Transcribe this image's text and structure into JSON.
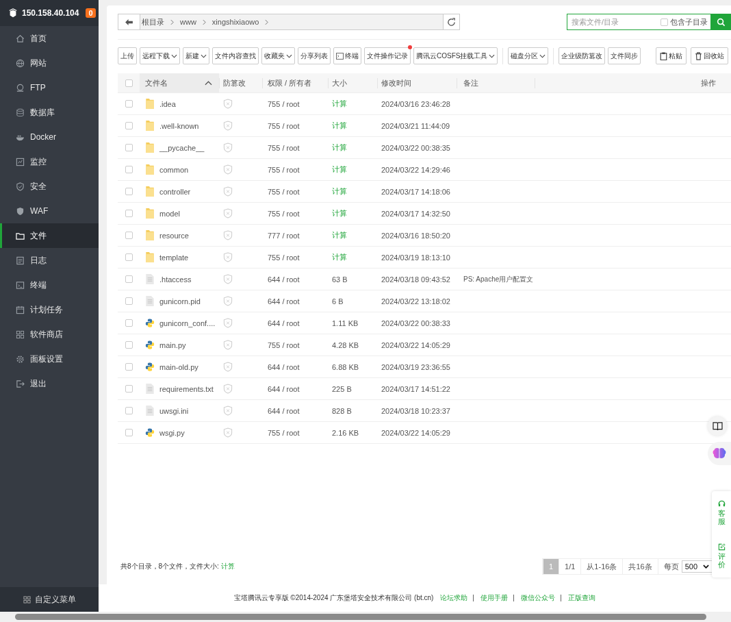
{
  "server": {
    "ip": "150.158.40.104",
    "badge": "0"
  },
  "nav": [
    {
      "label": "首页",
      "selected": false
    },
    {
      "label": "网站",
      "selected": false
    },
    {
      "label": "FTP",
      "selected": false
    },
    {
      "label": "数据库",
      "selected": false
    },
    {
      "label": "Docker",
      "selected": false
    },
    {
      "label": "监控",
      "selected": false
    },
    {
      "label": "安全",
      "selected": false
    },
    {
      "label": "WAF",
      "selected": false
    },
    {
      "label": "文件",
      "selected": true
    },
    {
      "label": "日志",
      "selected": false
    },
    {
      "label": "终端",
      "selected": false
    },
    {
      "label": "计划任务",
      "selected": false
    },
    {
      "label": "软件商店",
      "selected": false
    },
    {
      "label": "面板设置",
      "selected": false
    },
    {
      "label": "退出",
      "selected": false
    }
  ],
  "custom_menu": "自定义菜单",
  "breadcrumb": [
    "根目录",
    "www",
    "xingshixiaowo"
  ],
  "search": {
    "placeholder": "搜索文件/目录",
    "include_subdirs": {
      "label": "包含子目录",
      "checked": false
    }
  },
  "toolbar": {
    "main": [
      {
        "label": "上传",
        "kind": "plain"
      },
      {
        "label": "远程下载",
        "kind": "dropdown"
      },
      {
        "label": "新建",
        "kind": "dropdown"
      },
      {
        "label": "文件内容查找",
        "kind": "plain"
      },
      {
        "label": "收藏夹",
        "kind": "dropdown"
      },
      {
        "label": "分享列表",
        "kind": "plain"
      },
      {
        "label": "终端",
        "kind": "terminal"
      },
      {
        "label": "文件操作记录",
        "kind": "plain",
        "dot": true
      },
      {
        "label": "腾讯云COSFS挂载工具",
        "kind": "dropdown"
      },
      {
        "label": "磁盘分区",
        "kind": "dropdown",
        "separator_before": true
      },
      {
        "label": "企业级防篡改",
        "kind": "plain",
        "separator_before": true
      },
      {
        "label": "文件同步",
        "kind": "plain"
      }
    ],
    "right": [
      {
        "label": "粘贴",
        "kind": "paste"
      },
      {
        "label": "回收站",
        "kind": "trash"
      }
    ]
  },
  "select_all": {
    "checked": false
  },
  "columns": {
    "name": "文件名",
    "tamper": "防篡改",
    "perm": "权限 / 所有者",
    "size": "大小",
    "mtime": "修改时间",
    "note": "备注",
    "ops": "操作"
  },
  "rows": [
    {
      "name": ".idea",
      "kind": "folder",
      "perm": "755 / root",
      "size": "计算",
      "mtime": "2024/03/16 23:46:28",
      "checked": false
    },
    {
      "name": ".well-known",
      "kind": "folder",
      "perm": "755 / root",
      "size": "计算",
      "mtime": "2024/03/21 11:44:09",
      "checked": false
    },
    {
      "name": "__pycache__",
      "kind": "folder",
      "perm": "755 / root",
      "size": "计算",
      "mtime": "2024/03/22 00:38:35",
      "checked": false
    },
    {
      "name": "common",
      "kind": "folder",
      "perm": "755 / root",
      "size": "计算",
      "mtime": "2024/03/22 14:29:46",
      "checked": false
    },
    {
      "name": "controller",
      "kind": "folder",
      "perm": "755 / root",
      "size": "计算",
      "mtime": "2024/03/17 14:18:06",
      "checked": false
    },
    {
      "name": "model",
      "kind": "folder",
      "perm": "755 / root",
      "size": "计算",
      "mtime": "2024/03/17 14:32:50",
      "checked": false
    },
    {
      "name": "resource",
      "kind": "folder",
      "perm": "777 / root",
      "size": "计算",
      "mtime": "2024/03/16 18:50:20",
      "checked": false
    },
    {
      "name": "template",
      "kind": "folder",
      "perm": "755 / root",
      "size": "计算",
      "mtime": "2024/03/19 18:13:10",
      "checked": false
    },
    {
      "name": ".htaccess",
      "kind": "file",
      "perm": "644 / root",
      "size": "63 B",
      "mtime": "2024/03/18 09:43:52",
      "note": "PS: Apache用户配置文",
      "checked": false
    },
    {
      "name": "gunicorn.pid",
      "kind": "file",
      "perm": "644 / root",
      "size": "6 B",
      "mtime": "2024/03/22 13:18:02",
      "checked": false
    },
    {
      "name": "gunicorn_conf....",
      "kind": "python",
      "perm": "644 / root",
      "size": "1.11 KB",
      "mtime": "2024/03/22 00:38:33",
      "checked": false
    },
    {
      "name": "main.py",
      "kind": "python",
      "perm": "755 / root",
      "size": "4.28 KB",
      "mtime": "2024/03/22 14:05:29",
      "checked": false
    },
    {
      "name": "main-old.py",
      "kind": "python",
      "perm": "644 / root",
      "size": "6.88 KB",
      "mtime": "2024/03/19 23:36:55",
      "checked": false
    },
    {
      "name": "requirements.txt",
      "kind": "file",
      "perm": "644 / root",
      "size": "225 B",
      "mtime": "2024/03/17 14:51:22",
      "checked": false
    },
    {
      "name": "uwsgi.ini",
      "kind": "file",
      "perm": "644 / root",
      "size": "828 B",
      "mtime": "2024/03/18 10:23:37",
      "checked": false
    },
    {
      "name": "wsgi.py",
      "kind": "python",
      "perm": "755 / root",
      "size": "2.16 KB",
      "mtime": "2024/03/22 14:05:29",
      "checked": false
    }
  ],
  "summary": {
    "text": "共8个目录，8个文件，文件大小:",
    "link": "计算"
  },
  "pagination": {
    "pages": [
      {
        "label": "1",
        "selected": true
      }
    ],
    "page_of": "1/1",
    "range": "从1-16条",
    "total": "共16条",
    "per_page_label": "每页",
    "per_page": "500"
  },
  "footer": {
    "text": "宝塔腾讯云专享版 ©2014-2024 广东堡塔安全技术有限公司 (bt.cn)",
    "links": [
      "论坛求助",
      "使用手册",
      "微信公众号",
      "正版查询"
    ]
  },
  "side_tools": [
    {
      "label": "客服",
      "kind": "support"
    },
    {
      "label": "评价",
      "kind": "review"
    }
  ]
}
